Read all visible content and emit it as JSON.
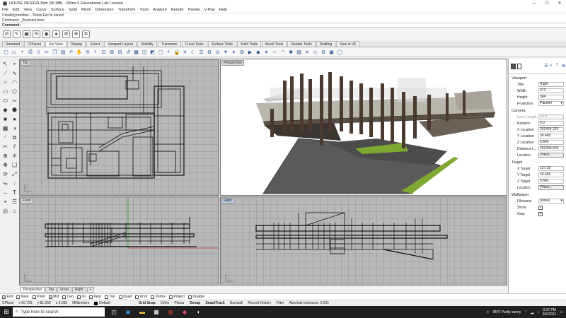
{
  "window": {
    "title": "HOUSE DESIGN.3dm (36 MB) - Rhino 6 Educational Lab License"
  },
  "menu": [
    "File",
    "Edit",
    "View",
    "Curve",
    "Surface",
    "Solid",
    "Mesh",
    "Dimension",
    "Transform",
    "Tools",
    "Analyze",
    "Render",
    "Panels",
    "V-Ray",
    "Help"
  ],
  "command": {
    "history": [
      "Creating meshes... Press Esc to cancel",
      "Command: _BooleanUnion"
    ],
    "prompt": "Command:"
  },
  "tabs": [
    "Standard",
    "CPlanes",
    "Set View",
    "Display",
    "Select",
    "Viewport Layout",
    "Visibility",
    "Transform",
    "Curve Tools",
    "Surface Tools",
    "Solid Tools",
    "Mesh Tools",
    "Render Tools",
    "Drafting",
    "New in V6"
  ],
  "active_tab": "Set View",
  "viewports": {
    "top": "Top",
    "perspective": "Perspective",
    "front": "Front",
    "right": "Right"
  },
  "viewport_tabs": [
    "Perspective",
    "Top",
    "Front",
    "Right",
    "+"
  ],
  "properties": {
    "viewport_section": "Viewport",
    "viewport": [
      {
        "k": "Title",
        "v": "Right"
      },
      {
        "k": "Width",
        "v": "973"
      },
      {
        "k": "Height",
        "v": "304"
      },
      {
        "k": "Projection",
        "v": "Parallel"
      }
    ],
    "camera_section": "Camera",
    "camera": [
      {
        "k": "Lens Length",
        "v": "50.0"
      },
      {
        "k": "Rotation",
        "v": "0.0"
      },
      {
        "k": "X Location",
        "v": "202424.222"
      },
      {
        "k": "Y Location",
        "v": "30.465"
      },
      {
        "k": "Z Location",
        "v": "5.642"
      },
      {
        "k": "Distance t...",
        "v": "202296.833"
      },
      {
        "k": "Location",
        "v": "Place..."
      }
    ],
    "target_section": "Target",
    "target": [
      {
        "k": "X Target",
        "v": "127.39"
      },
      {
        "k": "Y Target",
        "v": "30.465"
      },
      {
        "k": "Z Target",
        "v": "5.642"
      },
      {
        "k": "Location",
        "v": "Place..."
      }
    ],
    "wallpaper_section": "Wallpaper",
    "wallpaper": [
      {
        "k": "Filename",
        "v": "(none)"
      },
      {
        "k": "Show",
        "v": "✓"
      },
      {
        "k": "Gray",
        "v": "✓"
      }
    ]
  },
  "osnaps": [
    {
      "label": "End",
      "on": true
    },
    {
      "label": "Near",
      "on": false
    },
    {
      "label": "Point",
      "on": false
    },
    {
      "label": "Mid",
      "on": true
    },
    {
      "label": "Cen",
      "on": false
    },
    {
      "label": "Int",
      "on": false
    },
    {
      "label": "Perp",
      "on": false
    },
    {
      "label": "Tan",
      "on": false
    },
    {
      "label": "Quad",
      "on": false
    },
    {
      "label": "Knot",
      "on": false
    },
    {
      "label": "Vertex",
      "on": false
    },
    {
      "label": "Project",
      "on": false
    },
    {
      "label": "Disable",
      "on": false
    }
  ],
  "status": {
    "cplane": "CPlane",
    "x": "x 60.799",
    "y": "y 81.062",
    "z": "z 0.000",
    "units": "Millimeters",
    "layer": "Default",
    "grid_snap": "Grid Snap",
    "ortho": "Ortho",
    "planar": "Planar",
    "osnap": "Osnap",
    "smarttrack": "SmartTrack",
    "gumball": "Gumball",
    "record_history": "Record History",
    "filter": "Filter",
    "tolerance": "Absolute tolerance: 0.001"
  },
  "taskbar": {
    "search_placeholder": "Type here to search",
    "weather": "95°F Partly sunny",
    "time": "3:37 PM",
    "date": "9/6/2021"
  }
}
